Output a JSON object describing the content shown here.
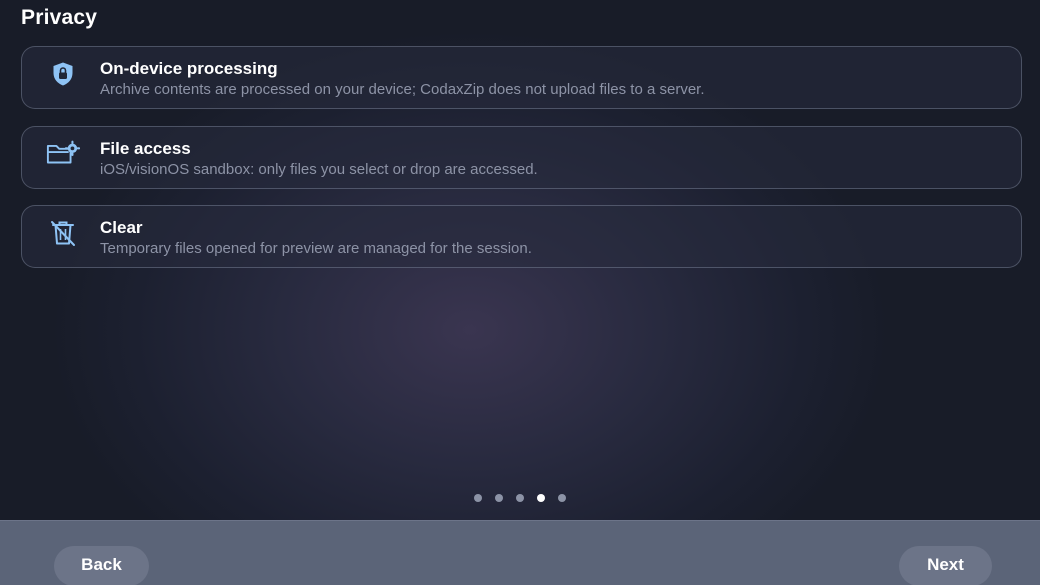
{
  "page": {
    "title": "Privacy"
  },
  "items": [
    {
      "icon": "shield-lock-icon",
      "title": "On-device processing",
      "description": "Archive contents are processed on your device; CodaxZip does not upload files to a server."
    },
    {
      "icon": "folder-gear-icon",
      "title": "File access",
      "description": "iOS/visionOS sandbox: only files you select or drop are accessed."
    },
    {
      "icon": "trash-slash-icon",
      "title": "Clear",
      "description": "Temporary files opened for preview are managed for the session."
    }
  ],
  "pagination": {
    "total": 5,
    "current": 4
  },
  "footer": {
    "back_label": "Back",
    "next_label": "Next"
  },
  "colors": {
    "icon_accent": "#8ec3f5",
    "active_dot": "#ffffff",
    "inactive_dot": "#8c93a6"
  }
}
